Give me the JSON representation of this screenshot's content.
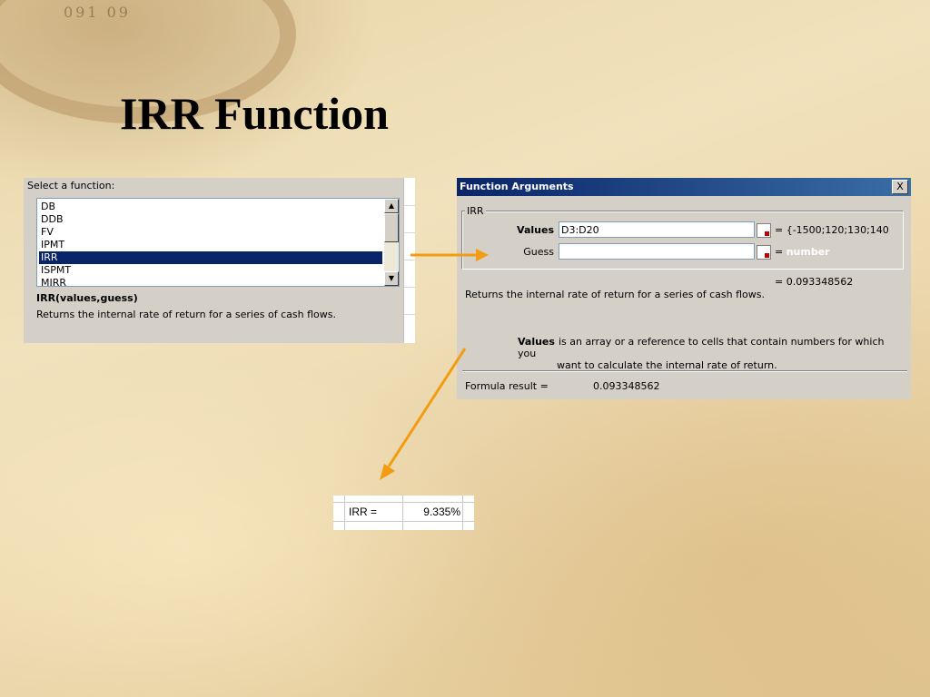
{
  "slide": {
    "title": "IRR Function",
    "compass_marks": "091  09"
  },
  "insert_dialog": {
    "label": "Select a function:",
    "functions": [
      "DB",
      "DDB",
      "FV",
      "IPMT",
      "IRR",
      "ISPMT",
      "MIRR"
    ],
    "selected_function": "IRR",
    "signature": "IRR(values,guess)",
    "description": "Returns the internal rate of return for a series of cash flows."
  },
  "function_args": {
    "title": "Function Arguments",
    "close_label": "X",
    "group": "IRR",
    "values_label": "Values",
    "values_input": "D3:D20",
    "values_eval": "= {-1500;120;130;140",
    "guess_label": "Guess",
    "guess_input": "",
    "guess_eval_prefix": "=",
    "guess_eval_hint": "number",
    "result": "= 0.093348562",
    "description": "Returns the internal rate of return for a series of cash flows.",
    "arg_help_name": "Values",
    "arg_help_text": "is an array or a reference to cells that contain numbers for which you",
    "arg_help_cont": "want to calculate the internal rate of return.",
    "formula_label": "Formula result =",
    "formula_value": "0.093348562"
  },
  "result_cell": {
    "label": "IRR =",
    "value": "9.335%"
  },
  "colors": {
    "arrow": "#f39c12",
    "selection": "#0a246a",
    "titlebar": "#0a246a"
  }
}
